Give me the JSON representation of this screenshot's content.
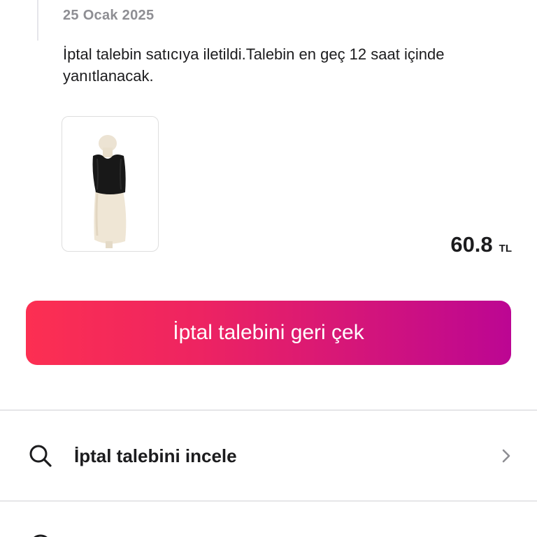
{
  "event": {
    "date": "25 Ocak 2025",
    "message": "İptal talebin satıcıya iletildi.Talebin en geç 12 saat içinde yanıtlanacak."
  },
  "product": {
    "image_icon": "black-crop-top-on-mannequin",
    "price": "60.8",
    "currency": "TL"
  },
  "actions": {
    "withdraw_label": "İptal talebini geri çek",
    "button_gradient": [
      "#fc2f52",
      "#bc0693"
    ]
  },
  "menu": {
    "items": [
      {
        "label": "İptal talebini incele",
        "icon": "search-icon",
        "trailing_icon": "chevron-right-icon"
      }
    ]
  }
}
